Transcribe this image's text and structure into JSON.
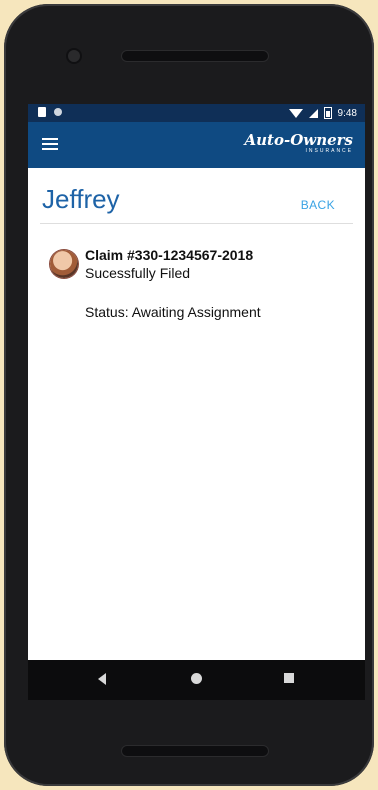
{
  "status_bar": {
    "time": "9:48"
  },
  "app_bar": {
    "brand_name": "Auto-Owners",
    "brand_sub": "INSURANCE"
  },
  "page": {
    "title": "Jeffrey",
    "back_label": "BACK"
  },
  "claim": {
    "title": "Claim #330-1234567-2018",
    "subtitle": "Sucessfully Filed",
    "status": "Status: Awaiting Assignment"
  },
  "colors": {
    "app_bar": "#0f4a82",
    "status_bar": "#0f2f57",
    "title_blue": "#1e63a7",
    "link_blue": "#3aa3e4"
  }
}
